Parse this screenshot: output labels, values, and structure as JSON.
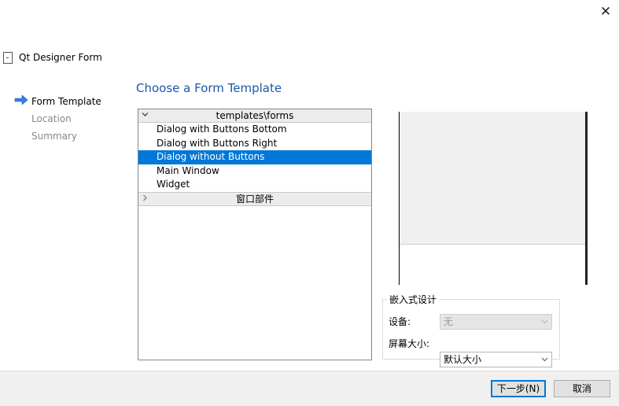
{
  "window": {
    "close_glyph": "✕",
    "title": "Qt Designer Form"
  },
  "wizard_steps": [
    {
      "label": "Form Template",
      "current": true
    },
    {
      "label": "Location",
      "current": false
    },
    {
      "label": "Summary",
      "current": false
    }
  ],
  "page": {
    "heading": "Choose a Form Template"
  },
  "templates": {
    "category_1": "templates\\forms",
    "items": [
      "Dialog with Buttons Bottom",
      "Dialog with Buttons Right",
      "Dialog without Buttons",
      "Main Window",
      "Widget"
    ],
    "selected_index": 2,
    "category_2": "窗口部件"
  },
  "embedded_design": {
    "group_title": "嵌入式设计",
    "device_label": "设备:",
    "device_value": "无",
    "screen_size_label": "屏幕大小:",
    "screen_size_value": "默认大小"
  },
  "footer": {
    "next_button": "下一步(N)",
    "cancel_button": "取消"
  },
  "colors": {
    "selection": "#0078d7",
    "heading": "#1c58a8",
    "step_arrow": "#3c7be6"
  },
  "icons": {
    "close": "close-icon",
    "form_file": "file-icon",
    "current_step": "arrow-right-icon",
    "expanded": "chevron-down-icon",
    "collapsed": "chevron-right-icon",
    "dropdown": "chevron-down-icon"
  }
}
